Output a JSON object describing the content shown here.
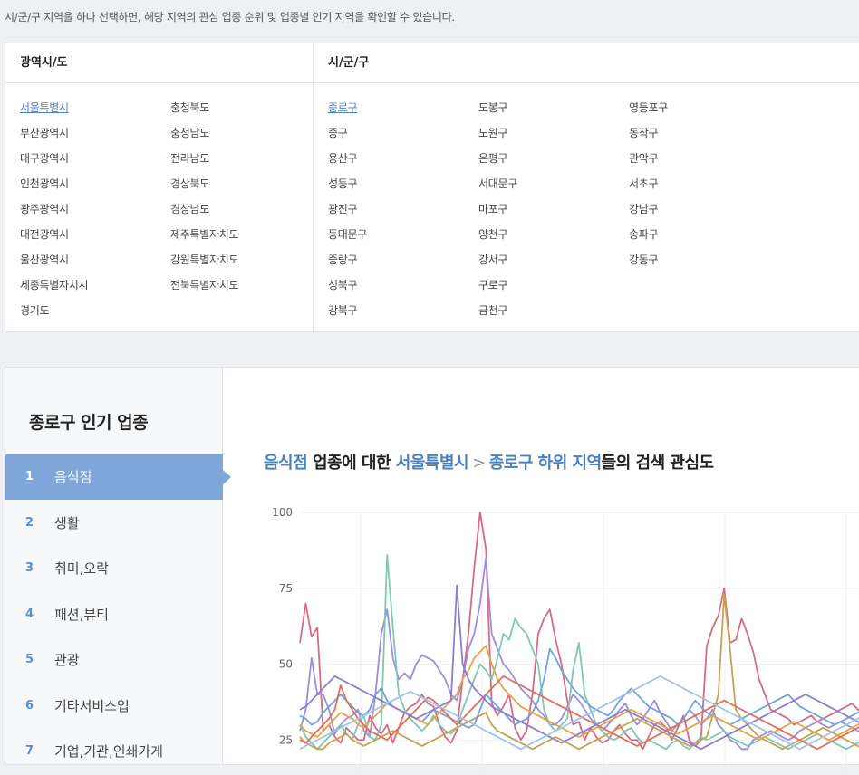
{
  "intro": "시/군/구 지역을 하나 선택하면, 해당 지역의 관심 업종 순위 및 업종별 인기 지역을 확인할 수 있습니다.",
  "provinces": {
    "header": "광역시/도",
    "selected": "서울특별시",
    "items": [
      "서울특별시",
      "부산광역시",
      "대구광역시",
      "인천광역시",
      "광주광역시",
      "대전광역시",
      "울산광역시",
      "세종특별자치시",
      "경기도",
      "충청북도",
      "충청남도",
      "전라남도",
      "경상북도",
      "경상남도",
      "제주특별자치도",
      "강원특별자치도",
      "전북특별자치도"
    ]
  },
  "districts": {
    "header": "시/군/구",
    "selected": "종로구",
    "items": [
      "종로구",
      "중구",
      "용산구",
      "성동구",
      "광진구",
      "동대문구",
      "중랑구",
      "성북구",
      "강북구",
      "도봉구",
      "노원구",
      "은평구",
      "서대문구",
      "마포구",
      "양천구",
      "강서구",
      "구로구",
      "금천구",
      "영등포구",
      "동작구",
      "관악구",
      "서초구",
      "강남구",
      "송파구",
      "강동구"
    ]
  },
  "sidebar": {
    "title": "종로구 인기 업종",
    "categories": [
      {
        "num": "1",
        "label": "음식점",
        "active": true
      },
      {
        "num": "2",
        "label": "생활",
        "active": false
      },
      {
        "num": "3",
        "label": "취미,오락",
        "active": false
      },
      {
        "num": "4",
        "label": "패션,뷰티",
        "active": false
      },
      {
        "num": "5",
        "label": "관광",
        "active": false
      },
      {
        "num": "6",
        "label": "기타서비스업",
        "active": false
      },
      {
        "num": "7",
        "label": "기업,기관,인쇄가게",
        "active": false
      }
    ]
  },
  "chart_title": {
    "category": "음식점",
    "mid": " 업종에 대한 ",
    "province": "서울특별시",
    "separator": ">",
    "region": "종로구 하위 지역",
    "suffix": "들의 검색 관심도"
  },
  "chart_data": {
    "type": "line",
    "title": "",
    "xlabel": "",
    "ylabel": "",
    "ylim": [
      0,
      100
    ],
    "yticks": [
      25,
      50,
      75,
      100
    ],
    "grid": true,
    "x": [
      1,
      2,
      3,
      4,
      5,
      6,
      7,
      8,
      9,
      10,
      11,
      12,
      13,
      14,
      15,
      16,
      17,
      18,
      19,
      20,
      21,
      22,
      23,
      24,
      25,
      26,
      27,
      28,
      29,
      30,
      31,
      32,
      33,
      34,
      35,
      36,
      37,
      38,
      39,
      40,
      41,
      42,
      43,
      44,
      45,
      46,
      47,
      48,
      49,
      50,
      51,
      52,
      53,
      54,
      55,
      56,
      57,
      58,
      59,
      60,
      61,
      62,
      63,
      64,
      65,
      66,
      67,
      68,
      69,
      70,
      71,
      72,
      73,
      74,
      75,
      76,
      77,
      78,
      79,
      80,
      81,
      82,
      83,
      84,
      85,
      86,
      87,
      88,
      89,
      90,
      91,
      92,
      93,
      94,
      95,
      96,
      97,
      98,
      99,
      100
    ],
    "series": [
      {
        "color": "#d86a84",
        "values": [
          57,
          70,
          59,
          62,
          28,
          30,
          26,
          24,
          29,
          27,
          25,
          25,
          33,
          29,
          27,
          30,
          24,
          29,
          34,
          36,
          37,
          40,
          37,
          36,
          30,
          26,
          24,
          28,
          45,
          60,
          82,
          100,
          88,
          37,
          33,
          36,
          40,
          29,
          25,
          28,
          40,
          60,
          65,
          68,
          58,
          50,
          38,
          30,
          31,
          25,
          29,
          26,
          24,
          25,
          28,
          30,
          27,
          25,
          25,
          22,
          26,
          30,
          31,
          29,
          25,
          29,
          33,
          25,
          23,
          25,
          56,
          62,
          66,
          75,
          57,
          58,
          65,
          60,
          54,
          45,
          40,
          35,
          34,
          33,
          32,
          30,
          31,
          32,
          33,
          31,
          32,
          33,
          34,
          35,
          36,
          37,
          35,
          34,
          33,
          32
        ]
      },
      {
        "color": "#9b8ee0",
        "values": [
          28,
          35,
          52,
          40,
          40,
          35,
          27,
          30,
          32,
          33,
          35,
          28,
          26,
          40,
          60,
          68,
          52,
          45,
          47,
          45,
          50,
          53,
          52,
          51,
          48,
          45,
          40,
          38,
          45,
          55,
          60,
          70,
          85,
          60,
          55,
          50,
          48,
          45,
          42,
          40,
          38,
          35,
          33,
          30,
          30,
          32,
          36,
          40,
          38,
          35,
          32,
          30,
          28,
          30,
          32,
          35,
          37,
          33,
          30,
          32,
          35,
          38,
          34,
          31,
          28,
          30,
          32,
          35,
          33,
          30,
          32,
          35,
          30,
          28,
          25,
          24,
          22,
          22,
          25,
          26,
          27,
          28,
          27,
          26,
          25,
          26,
          28,
          29,
          30,
          31,
          30,
          29,
          30,
          31,
          30,
          29,
          28,
          27,
          28,
          29
        ]
      },
      {
        "color": "#7ec8b3",
        "values": [
          30,
          26,
          24,
          22,
          24,
          26,
          28,
          30,
          27,
          25,
          30,
          33,
          26,
          25,
          30,
          86,
          62,
          40,
          35,
          32,
          30,
          28,
          30,
          33,
          30,
          28,
          27,
          29,
          35,
          40,
          45,
          50,
          48,
          45,
          52,
          60,
          58,
          65,
          62,
          60,
          55,
          50,
          35,
          30,
          28,
          30,
          32,
          48,
          57,
          40,
          35,
          30,
          28,
          26,
          25,
          26,
          28,
          29,
          26,
          24,
          25,
          24,
          23,
          22,
          24,
          25,
          23,
          22,
          24,
          26,
          25,
          26,
          27,
          28,
          26,
          25,
          24,
          23,
          24,
          25,
          26,
          25,
          24,
          23,
          22,
          23,
          24,
          25,
          26,
          27,
          26,
          25,
          24,
          23,
          22,
          23,
          24,
          25,
          24,
          23
        ]
      },
      {
        "color": "#c4a24f",
        "values": [
          26,
          24,
          23,
          22,
          22,
          24,
          25,
          26,
          27,
          25,
          24,
          23,
          24,
          25,
          26,
          27,
          28,
          27,
          26,
          25,
          24,
          23,
          24,
          25,
          26,
          27,
          28,
          29,
          30,
          31,
          32,
          33,
          34,
          30,
          28,
          27,
          26,
          25,
          24,
          23,
          22,
          23,
          24,
          25,
          26,
          25,
          24,
          23,
          22,
          23,
          24,
          25,
          26,
          27,
          28,
          29,
          30,
          31,
          32,
          31,
          30,
          29,
          28,
          27,
          26,
          25,
          24,
          23,
          24,
          25,
          26,
          33,
          40,
          73,
          55,
          35,
          32,
          30,
          28,
          26,
          25,
          24,
          23,
          22,
          23,
          24,
          25,
          26,
          27,
          28,
          29,
          28,
          27,
          26,
          25,
          24,
          23,
          22,
          23,
          24
        ]
      },
      {
        "color": "#6fa3de",
        "values": [
          33,
          32,
          30,
          31,
          34,
          36,
          38,
          40,
          38,
          36,
          34,
          33,
          35,
          40,
          42,
          38,
          36,
          35,
          34,
          33,
          32,
          31,
          33,
          35,
          34,
          33,
          32,
          31,
          30,
          29,
          30,
          35,
          40,
          38,
          36,
          34,
          32,
          30,
          31,
          32,
          34,
          38,
          45,
          55,
          52,
          48,
          45,
          42,
          40,
          38,
          36,
          35,
          34,
          33,
          35,
          38,
          40,
          42,
          40,
          38,
          36,
          35,
          34,
          33,
          32,
          30,
          32,
          35,
          38,
          36,
          34,
          33,
          32,
          31,
          30,
          31,
          32,
          33,
          34,
          35,
          36,
          37,
          38,
          39,
          40,
          38,
          36,
          35,
          34,
          33,
          32,
          31,
          30,
          31,
          32,
          33,
          34,
          35,
          34,
          33
        ]
      },
      {
        "color": "#e8a24a",
        "values": [
          30,
          28,
          27,
          26,
          28,
          30,
          32,
          34,
          33,
          32,
          30,
          29,
          31,
          33,
          35,
          37,
          36,
          35,
          34,
          33,
          32,
          31,
          30,
          32,
          34,
          36,
          38,
          40,
          45,
          48,
          52,
          54,
          56,
          50,
          45,
          42,
          40,
          38,
          36,
          35,
          34,
          33,
          32,
          31,
          30,
          29,
          28,
          27,
          26,
          27,
          28,
          29,
          30,
          31,
          32,
          33,
          34,
          35,
          34,
          33,
          32,
          31,
          30,
          29,
          28,
          27,
          28,
          29,
          30,
          31,
          32,
          33,
          32,
          31,
          30,
          29,
          28,
          27,
          26,
          25,
          26,
          27,
          28,
          29,
          30,
          31,
          30,
          29,
          28,
          27,
          26,
          25,
          26,
          27,
          28,
          29,
          30,
          31,
          30,
          29
        ]
      },
      {
        "color": "#e06f5a",
        "values": [
          25,
          24,
          26,
          28,
          30,
          32,
          35,
          43,
          38,
          35,
          32,
          30,
          28,
          27,
          26,
          25,
          27,
          29,
          31,
          33,
          35,
          37,
          39,
          38,
          36,
          34,
          32,
          30,
          32,
          34,
          36,
          38,
          40,
          42,
          44,
          46,
          45,
          44,
          43,
          42,
          41,
          40,
          39,
          38,
          37,
          36,
          35,
          34,
          33,
          32,
          31,
          30,
          29,
          28,
          27,
          26,
          25,
          24,
          23,
          24,
          25,
          26,
          27,
          28,
          29,
          30,
          31,
          32,
          33,
          34,
          35,
          36,
          37,
          38,
          37,
          36,
          35,
          34,
          33,
          32,
          31,
          30,
          29,
          28,
          27,
          26,
          25,
          24,
          23,
          22,
          23,
          24,
          25,
          26,
          27,
          28,
          29,
          30,
          31,
          32
        ]
      },
      {
        "color": "#8b7fd0",
        "values": [
          35,
          36,
          38,
          40,
          42,
          44,
          46,
          45,
          44,
          43,
          42,
          41,
          40,
          39,
          38,
          37,
          36,
          35,
          34,
          33,
          32,
          33,
          34,
          35,
          36,
          37,
          38,
          76,
          50,
          45,
          42,
          40,
          38,
          36,
          35,
          34,
          33,
          32,
          31,
          30,
          29,
          28,
          27,
          26,
          25,
          24,
          25,
          26,
          27,
          28,
          29,
          30,
          31,
          32,
          33,
          34,
          35,
          34,
          33,
          32,
          31,
          30,
          29,
          28,
          27,
          26,
          25,
          24,
          23,
          22,
          23,
          24,
          25,
          26,
          27,
          28,
          29,
          30,
          31,
          32,
          33,
          34,
          35,
          36,
          37,
          38,
          39,
          40,
          39,
          38,
          37,
          36,
          35,
          34,
          33,
          32,
          31,
          30,
          29,
          28
        ]
      },
      {
        "color": "#a0c4ef",
        "values": [
          22,
          23,
          24,
          25,
          26,
          27,
          28,
          29,
          30,
          31,
          32,
          33,
          34,
          35,
          36,
          37,
          38,
          39,
          40,
          41,
          40,
          39,
          38,
          37,
          36,
          35,
          34,
          33,
          32,
          31,
          30,
          29,
          28,
          27,
          26,
          25,
          24,
          23,
          22,
          23,
          24,
          25,
          26,
          27,
          28,
          29,
          30,
          31,
          32,
          33,
          34,
          35,
          36,
          37,
          38,
          39,
          40,
          41,
          42,
          43,
          44,
          45,
          46,
          45,
          44,
          43,
          42,
          41,
          40,
          39,
          38,
          37,
          36,
          35,
          34,
          33,
          32,
          31,
          30,
          29,
          28,
          27,
          26,
          25,
          24,
          23,
          22,
          23,
          24,
          25,
          26,
          27,
          28,
          29,
          30,
          31,
          32,
          33,
          34,
          35
        ]
      }
    ]
  }
}
